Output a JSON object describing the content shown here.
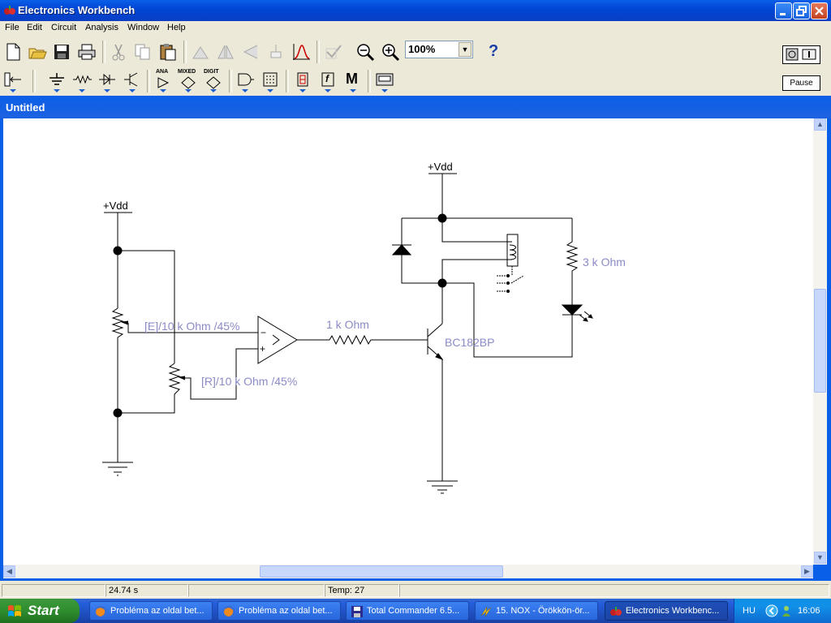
{
  "window": {
    "title": "Electronics Workbench"
  },
  "menu": [
    "File",
    "Edit",
    "Circuit",
    "Analysis",
    "Window",
    "Help"
  ],
  "toolbar": {
    "zoom_value": "100%",
    "help_label": "?",
    "pause_label": "Pause"
  },
  "parts_bin": {
    "analog_ic_label": "ANA",
    "mixed_ic_label": "MIXED",
    "digital_ic_label": "DIGIT",
    "misc_label": "M",
    "logic_label": "f"
  },
  "document": {
    "title": "Untitled"
  },
  "circuit": {
    "left_supply": "+Vdd",
    "right_supply": "+Vdd",
    "pot_e_label": "[E]/10 k Ohm /45%",
    "pot_r_label": "[R]/10 k Ohm /45%",
    "base_resistor_label": "1 k Ohm",
    "transistor_label": "BC182BP",
    "led_resistor_label": "3 k Ohm"
  },
  "status": {
    "time": "24.74 s",
    "temp": "Temp:  27"
  },
  "taskbar": {
    "start_label": "Start",
    "tasks": [
      {
        "label": "Probléma az oldal bet...",
        "icon": "firefox-icon"
      },
      {
        "label": "Probléma az oldal bet...",
        "icon": "firefox-icon"
      },
      {
        "label": "Total Commander 6.5...",
        "icon": "floppy-icon"
      },
      {
        "label": "15. NOX - Örökkön-ör...",
        "icon": "winamp-icon"
      },
      {
        "label": "Electronics Workbenc...",
        "icon": "ewb-icon"
      }
    ],
    "language": "HU",
    "clock": "16:06"
  }
}
